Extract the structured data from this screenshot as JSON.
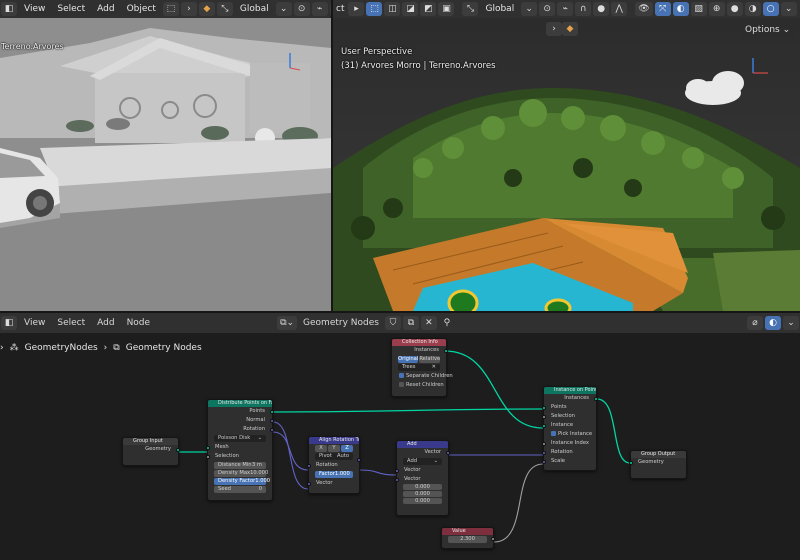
{
  "left_header": {
    "menus": [
      "View",
      "Select",
      "Add",
      "Object"
    ],
    "orientation": "Global"
  },
  "right_header": {
    "menu_fragment": "ct",
    "orientation": "Global",
    "options_label": "Options"
  },
  "left_viewport": {
    "object_label": "Terreno.Arvores"
  },
  "right_viewport": {
    "view_name": "User Perspective",
    "object_info": "(31) Arvores Morro | Terreno.Arvores"
  },
  "node_editor": {
    "menus": [
      "View",
      "Select",
      "Add",
      "Node"
    ],
    "tree_name": "Geometry Nodes",
    "breadcrumb": [
      "GeometryNodes",
      "Geometry Nodes"
    ],
    "colors": {
      "geometry_socket": "#00d6a3",
      "vector_socket": "#6363c7",
      "float_socket": "#a1a1a1",
      "geometry_header": "#0e7660",
      "vector_header": "#3a3a8c",
      "input_header": "#7e2f3d"
    },
    "nodes": {
      "collection_info": {
        "title": "Collection Info",
        "out": "Instances",
        "transform": [
          "Original",
          "Relative"
        ],
        "collection": "Trees",
        "separate_children": "Separate Children",
        "reset_children": "Reset Children"
      },
      "group_input": {
        "title": "Group Input",
        "out": "Geometry"
      },
      "distribute": {
        "title": "Distribute Points on Fac...",
        "outputs": [
          "Points",
          "Normal",
          "Rotation"
        ],
        "mode": "Poisson Disk",
        "inputs": [
          "Mesh",
          "Selection"
        ],
        "distance_min_label": "Distance Min",
        "distance_min_value": "3 m",
        "density_max_label": "Density Max",
        "density_max_value": "10.000",
        "density_factor_label": "Density Factor",
        "density_factor_value": "1.000",
        "seed_label": "Seed",
        "seed_value": "0"
      },
      "align": {
        "title": "Align Rotation To V...",
        "axes": [
          "X",
          "Y",
          "Z"
        ],
        "pivot_label": "Pivot",
        "pivot_value": "Auto",
        "out": "Rotation",
        "rotation_in": "Rotation",
        "factor_label": "Factor",
        "factor_value": "1.000",
        "vector_in": "Vector"
      },
      "add": {
        "title": "Add",
        "out": "Vector",
        "operation": "Add",
        "in1": "Vector",
        "in2": "Vector",
        "values": [
          "0.000",
          "0.000",
          "0.000"
        ]
      },
      "value": {
        "title": "Value",
        "value": "2.300"
      },
      "instance": {
        "title": "Instance on Points",
        "out": "Instances",
        "inputs": [
          "Points",
          "Selection",
          "Instance"
        ],
        "pick_instance": "Pick Instance",
        "inputs2": [
          "Instance Index",
          "Rotation",
          "Scale"
        ]
      },
      "group_output": {
        "title": "Group Output",
        "in": "Geometry"
      }
    }
  }
}
